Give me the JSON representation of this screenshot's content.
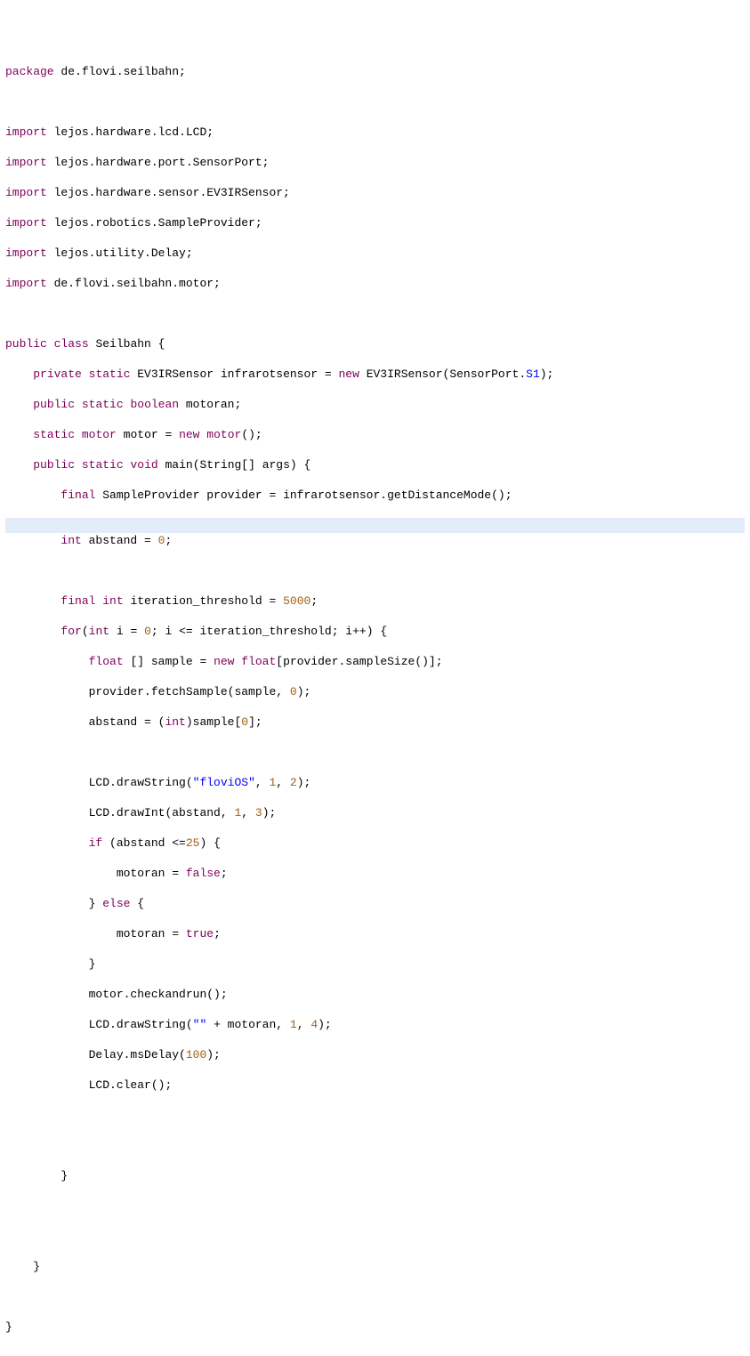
{
  "tokens": {
    "kw_package": "package",
    "kw_import": "import",
    "kw_public": "public",
    "kw_private": "private",
    "kw_class": "class",
    "kw_static": "static",
    "kw_boolean": "boolean",
    "kw_void": "void",
    "kw_final": "final",
    "kw_int": "int",
    "kw_float": "float",
    "kw_new": "new",
    "kw_for": "for",
    "kw_if": "if",
    "kw_else": "else",
    "kw_true": "true",
    "kw_false": "false",
    "kw_motor": "motor"
  },
  "pkg": " de.flovi.seilbahn;",
  "imports": {
    "i0": " lejos.hardware.lcd.LCD;",
    "i1": " lejos.hardware.port.SensorPort;",
    "i2": " lejos.hardware.sensor.EV3IRSensor;",
    "i3": " lejos.robotics.SampleProvider;",
    "i4": " lejos.utility.Delay;",
    "i5": " de.flovi.seilbahn.motor;"
  },
  "cls": {
    "decl_tail": " Seilbahn {",
    "f1a": " EV3IRSensor infrarotsensor = ",
    "f1b": " EV3IRSensor(SensorPort.",
    "f1_port": "S1",
    "f1c": ");",
    "f2_tail": " motoran;",
    "f3a": " motor = ",
    "f3b": "();",
    "main_sig": " main(String[] args) {",
    "prov": " SampleProvider provider = infrarotsensor.getDistanceMode();",
    "abstand_decl_a": " abstand = ",
    "abstand_init": "0",
    "iter_decl_a": " iteration_threshold = ",
    "iter_val": "5000",
    "for_a": "(",
    "for_i_init_a": " i = ",
    "for_i0": "0",
    "for_cond": "; i <= iteration_threshold; i++) {",
    "sample_a": " [] sample = ",
    "sample_b": "[provider.sampleSize()];",
    "fetch": "provider.fetchSample(sample, ",
    "fetch_idx": "0",
    "fetch_tail": ");",
    "assign_a": "abstand = (",
    "assign_b": ")sample[",
    "assign_idx": "0",
    "assign_tail": "];",
    "lcd_str1_a": "LCD.drawString(",
    "lcd_str1_s": "\"floviOS\"",
    "lcd_str1_b": ", ",
    "lcd_str1_x": "1",
    "lcd_str1_c": ", ",
    "lcd_str1_y": "2",
    "lcd_str1_d": ");",
    "lcd_int_a": "LCD.drawInt(abstand, ",
    "lcd_int_x": "1",
    "lcd_int_b": ", ",
    "lcd_int_y": "3",
    "lcd_int_c": ");",
    "if_a": " (abstand <=",
    "if_thresh": "25",
    "if_b": ") {",
    "mot_false": "motoran = ",
    "mot_false_tail": ";",
    "else_a": "} ",
    "else_b": " {",
    "mot_true": "motoran = ",
    "mot_true_tail": ";",
    "close_brace": "}",
    "checkrun": "motor.checkandrun();",
    "lcd_str2_a": "LCD.drawString(",
    "lcd_str2_s": "\"\"",
    "lcd_str2_b": " + motoran, ",
    "lcd_str2_x": "1",
    "lcd_str2_c": ", ",
    "lcd_str2_y": "4",
    "lcd_str2_d": ");",
    "delay_a": "Delay.msDelay(",
    "delay_ms": "100",
    "delay_b": ");",
    "lcd_clear": "LCD.clear();"
  },
  "misc": {
    "semi": ";",
    "space": " "
  }
}
